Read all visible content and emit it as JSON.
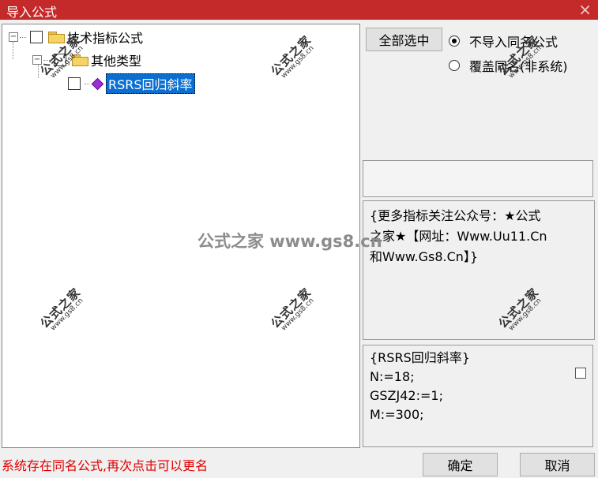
{
  "window": {
    "title": "导入公式",
    "close_icon": "×"
  },
  "tree": {
    "root_label": "技术指标公式",
    "child_label": "其他类型",
    "leaf_label": "RSRS回归斜率",
    "expander_collapse": "−"
  },
  "buttons": {
    "select_all": "全部选中",
    "ok": "确定",
    "cancel": "取消"
  },
  "options": {
    "no_import_same": "不导入同名公式",
    "overwrite_same": "覆盖同名(非系统)",
    "selected": "no_import_same"
  },
  "info_note": {
    "line1": "{更多指标关注公众号：★公式",
    "line2": "之家★【网址：Www.Uu11.Cn",
    "line3": "和Www.Gs8.Cn】}"
  },
  "code_preview": {
    "lines": [
      "{RSRS回归斜率}",
      "N:=18;",
      "GSZJ42:=1;",
      "M:=300;"
    ]
  },
  "status_text": "系统存在同名公式,再次点击可以更名",
  "watermark": {
    "big": "公式之家",
    "small": "www.gs8.cn",
    "center": "公式之家 www.gs8.cn"
  },
  "colors": {
    "titlebar": "#c42a2a",
    "selection": "#0a6fd1",
    "status": "#e00000"
  }
}
